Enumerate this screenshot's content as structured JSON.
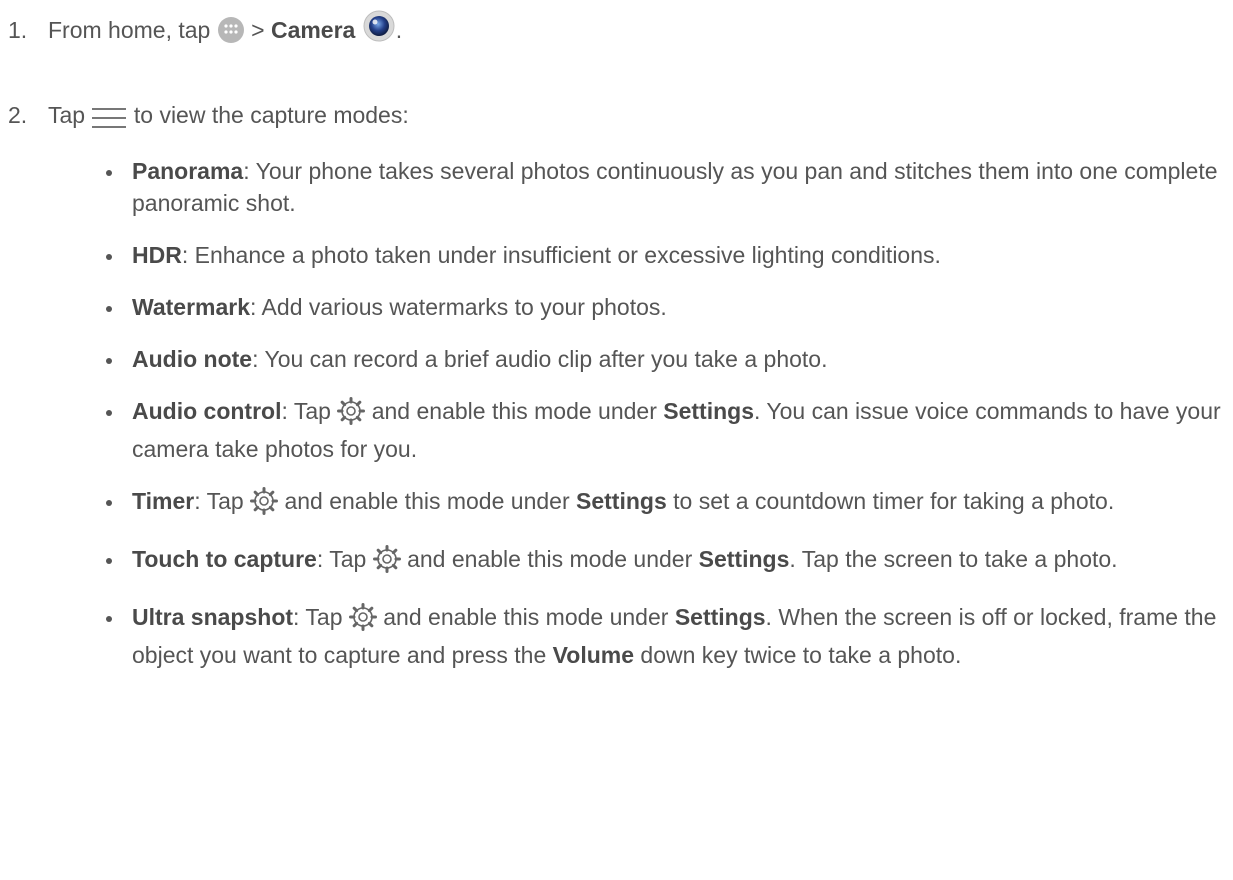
{
  "steps": [
    {
      "number": "1.",
      "pre_icon_text": "From home, tap",
      "apps_icon": "apps-icon",
      "separator": ">",
      "bold": "Camera",
      "camera_icon": "camera-app-icon",
      "end": "."
    },
    {
      "number": "2.",
      "pre_icon_text": "Tap",
      "menu_icon": "menu-icon",
      "post_icon_text": "to view the capture modes:"
    }
  ],
  "modes": [
    {
      "name": "Panorama",
      "desc": ": Your phone takes several photos continuously as you pan and stitches them into one complete panoramic shot."
    },
    {
      "name": "HDR",
      "desc": ": Enhance a photo taken under insufficient or excessive lighting conditions."
    },
    {
      "name": "Watermark",
      "desc": ": Add various watermarks to your photos."
    },
    {
      "name": "Audio note",
      "desc": ": You can record a brief audio clip after you take a photo."
    },
    {
      "name": "Audio control",
      "tap": ": Tap",
      "icon": "settings-gear-icon",
      "mid": "and enable this mode under",
      "settings": "Settings",
      "rest": ". You can issue voice commands to have your camera take photos for you."
    },
    {
      "name": "Timer",
      "tap": ": Tap",
      "icon": "settings-gear-icon",
      "mid": "and enable this mode under",
      "settings": "Settings",
      "rest": " to set a countdown timer for taking a photo."
    },
    {
      "name": "Touch to capture",
      "tap": ": Tap",
      "icon": "settings-gear-icon",
      "mid": "and enable this mode under",
      "settings": "Settings",
      "rest": ". Tap the screen to take a photo."
    },
    {
      "name": "Ultra snapshot",
      "tap": ": Tap",
      "icon": "settings-gear-icon",
      "mid": "and enable this mode under",
      "settings": "Settings",
      "rest": ". When the screen is off or locked, frame the object you want to capture and press the ",
      "volume": "Volume",
      "rest2": " down key twice to take a photo."
    }
  ]
}
